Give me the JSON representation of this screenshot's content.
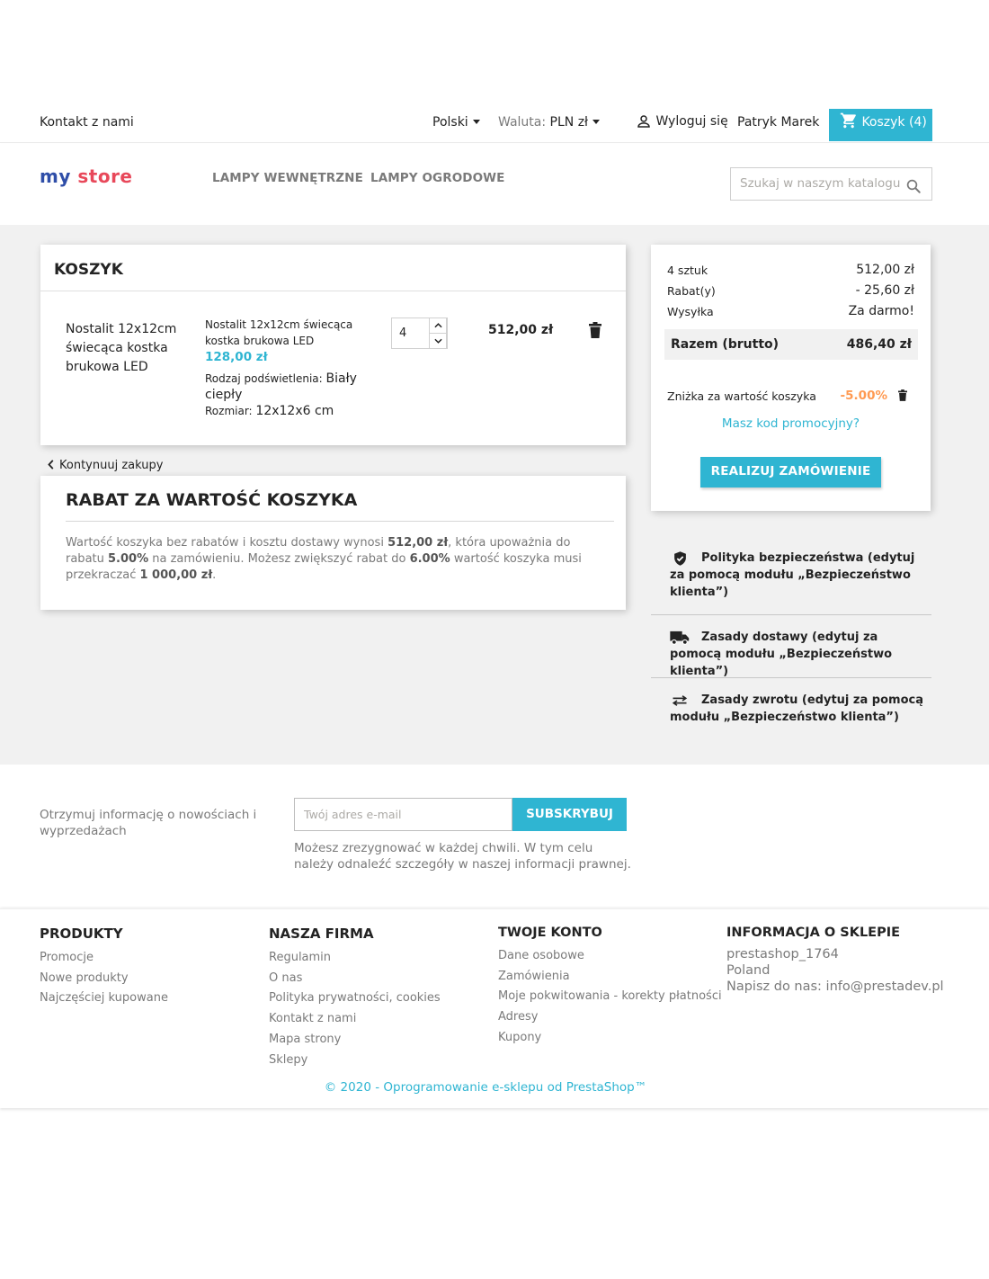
{
  "topnav": {
    "contact": "Kontakt z nami",
    "language": "Polski",
    "currency_label": "Waluta:",
    "currency_value": "PLN zł",
    "logout": "Wyloguj się",
    "user_name": "Patryk Marek",
    "cart_label": "Koszyk (4)"
  },
  "header": {
    "logo_my": "my",
    "logo_store": "store",
    "menu": [
      "LAMPY WEWNĘTRZNE",
      "LAMPY OGRODOWE"
    ],
    "search_placeholder": "Szukaj w naszym katalogu"
  },
  "cart": {
    "title": "KOSZYK",
    "item": {
      "name": "Nostalit 12x12cm świecąca kostka brukowa LED",
      "short_name": "Nostalit 12x12cm świecąca kostka brukowa LED",
      "unit_price": "128,00 zł",
      "attr1_label": "Rodzaj podświetlenia:",
      "attr1_value": "Biały ciepły",
      "attr2_label": "Rozmiar:",
      "attr2_value": "12x12x6 cm",
      "quantity": "4",
      "total": "512,00 zł"
    },
    "continue": "Kontynuuj zakupy"
  },
  "discount": {
    "title": "RABAT ZA WARTOŚĆ KOSZYKA",
    "t1": "Wartość koszyka bez rabatów i kosztu dostawy wynosi ",
    "b1": "512,00 zł",
    "t2": ", która upoważnia do rabatu ",
    "b2": "5.00%",
    "t3": " na zamówieniu. Możesz zwiększyć rabat do ",
    "b3": "6.00%",
    "t4": " wartość koszyka musi przekraczać ",
    "b4": "1 000,00 zł",
    "t5": "."
  },
  "summary": {
    "items_label": "4 sztuk",
    "items_value": "512,00 zł",
    "discount_label": "Rabat(y)",
    "discount_value": "- 25,60 zł",
    "shipping_label": "Wysyłka",
    "shipping_value": "Za darmo!",
    "total_label": "Razem (brutto)",
    "total_value": "486,40 zł",
    "voucher_label": "Zniżka za wartość koszyka",
    "voucher_value": "-5.00%",
    "promo_link": "Masz kod promocyjny?",
    "checkout": "REALIZUJ ZAMÓWIENIE",
    "accent_color": "#2fb5d2",
    "voucher_color": "#ff9a52"
  },
  "reassurance": [
    {
      "icon": "shield-check-icon",
      "text": "Polityka bezpieczeństwa (edytuj za pomocą modułu „Bezpieczeństwo klienta”)"
    },
    {
      "icon": "truck-icon",
      "text": "Zasady dostawy (edytuj za pomocą modułu „Bezpieczeństwo klienta”)"
    },
    {
      "icon": "swap-arrows-icon",
      "text": "Zasady zwrotu (edytuj za pomocą modułu „Bezpieczeństwo klienta”)"
    }
  ],
  "newsletter": {
    "label": "Otrzymuj informację o nowościach i wyprzedażach",
    "placeholder": "Twój adres e-mail",
    "button": "SUBSKRYBUJ",
    "note": "Możesz zrezygnować w każdej chwili. W tym celu należy odnaleźć szczegóły w naszej informacji prawnej."
  },
  "footer": {
    "products": {
      "title": "PRODUKTY",
      "links": [
        "Promocje",
        "Nowe produkty",
        "Najczęściej kupowane"
      ]
    },
    "company": {
      "title": "NASZA FIRMA",
      "links": [
        "Regulamin",
        "O nas",
        "Polityka prywatności, cookies",
        "Kontakt z nami",
        "Mapa strony",
        "Sklepy"
      ]
    },
    "account": {
      "title": "TWOJE KONTO",
      "links": [
        "Dane osobowe",
        "Zamówienia",
        "Moje pokwitowania - korekty płatności",
        "Adresy",
        "Kupony"
      ]
    },
    "store": {
      "title": "INFORMACJA O SKLEPIE",
      "lines": [
        "prestashop_1764",
        "Poland",
        "Napisz do nas: info@prestadev.pl"
      ]
    },
    "copyright": "© 2020 - Oprogramowanie e-sklepu od PrestaShop™"
  }
}
